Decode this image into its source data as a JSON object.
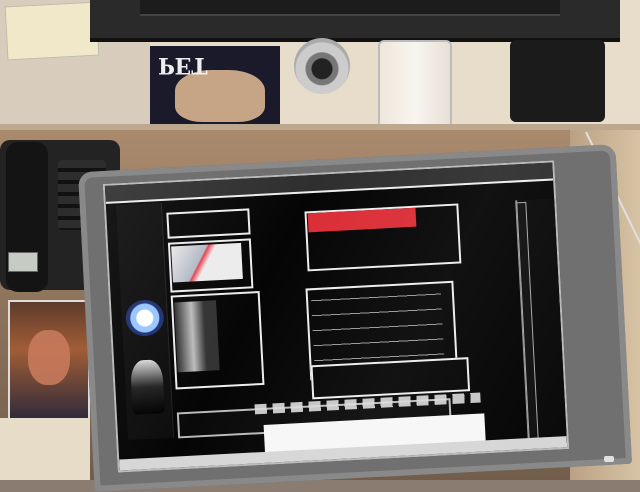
{
  "scene": {
    "top_poster_title": "PET",
    "browser_title": "",
    "website": {
      "header_banner_text": "",
      "main_heading": "",
      "bottom_heading": "",
      "left_caption": ""
    },
    "taskbar_text": ""
  }
}
